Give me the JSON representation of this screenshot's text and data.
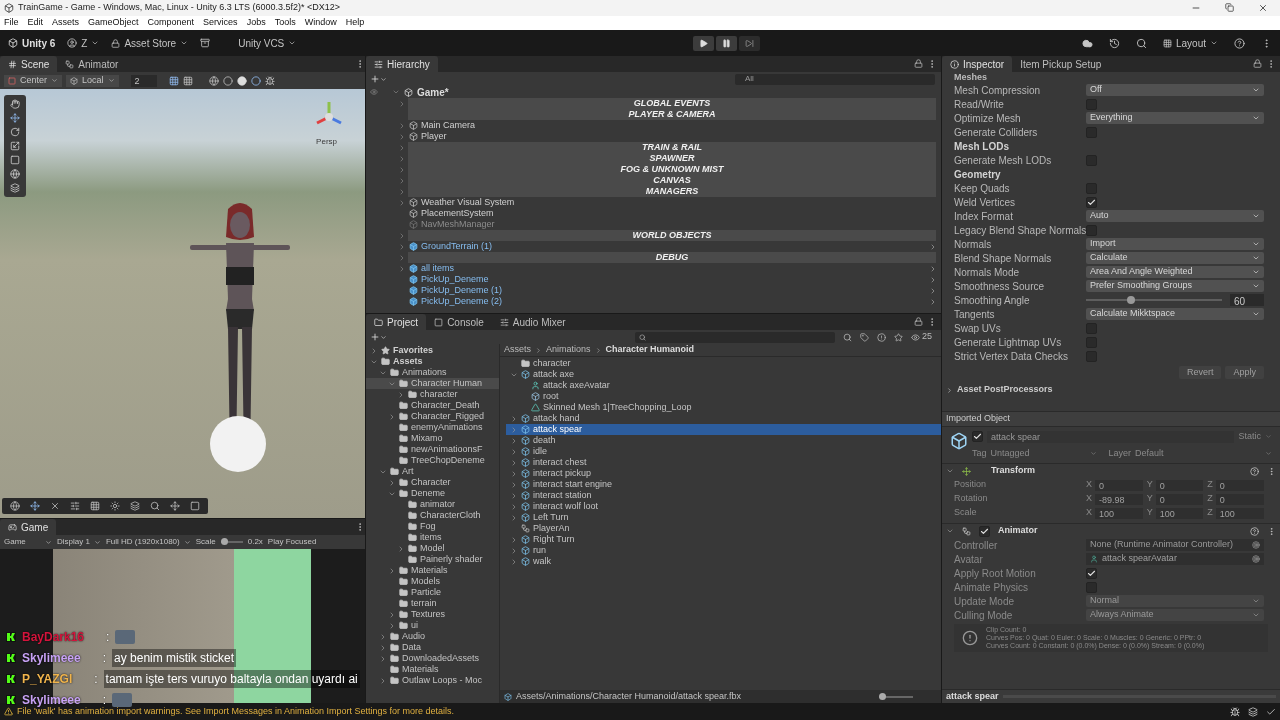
{
  "title_bar": {
    "title": "TrainGame - Game - Windows, Mac, Linux - Unity 6.3 LTS (6000.3.5f2)* <DX12>"
  },
  "menu": [
    "File",
    "Edit",
    "Assets",
    "GameObject",
    "Component",
    "Services",
    "Jobs",
    "Tools",
    "Window",
    "Help"
  ],
  "toolbar": {
    "product": "Unity 6",
    "account": "Z",
    "asset_store": "Asset Store",
    "vcs": "Unity VCS",
    "layout": "Layout"
  },
  "scene": {
    "tabs": [
      {
        "label": "Scene",
        "selected": true
      },
      {
        "label": "Animator",
        "selected": false
      }
    ],
    "pivot": "Center",
    "space": "Local",
    "snap": "2",
    "projection": "Persp"
  },
  "game": {
    "tab": "Game",
    "view": "Game",
    "display": "Display 1",
    "resolution": "Full HD (1920x1080)",
    "scale": {
      "label": "Scale",
      "level": 0.15,
      "reading": "0.2x"
    },
    "play_focused": "Play Focused"
  },
  "chat": [
    {
      "name": "BayDark16",
      "color": "#d4143c",
      "separator": ":",
      "emote": true
    },
    {
      "name": "Skylimeee",
      "color": "#c8a2f5",
      "separator": ":",
      "message": "ay benim mistik sticket",
      "emote": false
    },
    {
      "name": "P_YAZGI",
      "color": "#f0b44c",
      "separator": ":",
      "message": "tamam işte ters vuruyo baltayla ondan uyardı ai",
      "emote": false
    },
    {
      "name": "Skylimeee",
      "color": "#c8a2f5",
      "separator": ":",
      "emote": true
    }
  ],
  "hierarchy": {
    "title": "Hierarchy",
    "search": {
      "placeholder": "All"
    },
    "scene": "Game*",
    "rows": [
      {
        "kind": "header",
        "label": "GLOBAL EVENTS",
        "expandable": true
      },
      {
        "kind": "header",
        "label": "PLAYER & CAMERA",
        "expandable": false
      },
      {
        "kind": "object",
        "label": "Main Camera",
        "expandable": true,
        "prefab": false,
        "disabled": false
      },
      {
        "kind": "object",
        "label": "Player",
        "expandable": true,
        "prefab": false,
        "disabled": false
      },
      {
        "kind": "header",
        "label": "TRAIN & RAIL",
        "expandable": true
      },
      {
        "kind": "header",
        "label": "SPAWNER",
        "expandable": true
      },
      {
        "kind": "header",
        "label": "FOG & UNKNOWN MIST",
        "expandable": true
      },
      {
        "kind": "header",
        "label": "CANVAS",
        "expandable": true
      },
      {
        "kind": "header",
        "label": "MANAGERS",
        "expandable": true
      },
      {
        "kind": "object",
        "label": "Weather Visual System",
        "expandable": true,
        "prefab": false,
        "disabled": false
      },
      {
        "kind": "object",
        "label": "PlacementSystem",
        "expandable": false,
        "prefab": false,
        "disabled": false
      },
      {
        "kind": "object",
        "label": "NavMeshManager",
        "expandable": false,
        "prefab": false,
        "disabled": true
      },
      {
        "kind": "header",
        "label": "WORLD OBJECTS",
        "expandable": true
      },
      {
        "kind": "object",
        "label": "GroundTerrain (1)",
        "expandable": true,
        "prefab": true,
        "disabled": false
      },
      {
        "kind": "header",
        "label": "DEBUG",
        "expandable": true
      },
      {
        "kind": "object",
        "label": "all items",
        "expandable": true,
        "prefab": true,
        "disabled": false
      },
      {
        "kind": "object",
        "label": "PickUp_Deneme",
        "expandable": false,
        "prefab": true,
        "disabled": false
      },
      {
        "kind": "object",
        "label": "PickUp_Deneme (1)",
        "expandable": false,
        "prefab": true,
        "disabled": false
      },
      {
        "kind": "object",
        "label": "PickUp_Deneme (2)",
        "expandable": false,
        "prefab": true,
        "disabled": false
      }
    ]
  },
  "project": {
    "tabs": [
      {
        "label": "Project",
        "selected": true
      },
      {
        "label": "Console",
        "selected": false
      },
      {
        "label": "Audio Mixer",
        "selected": false
      }
    ],
    "visible_count": "25",
    "breadcrumb": [
      "Assets",
      "Animations",
      "Character Humanoid"
    ],
    "tree": [
      {
        "label": "Favorites",
        "kind": "favorites",
        "expanded": false,
        "selected": false
      },
      {
        "label": "Assets",
        "expanded": true,
        "selected": false,
        "children": [
          {
            "label": "Animations",
            "expanded": true,
            "selected": false,
            "children": [
              {
                "label": "Character Human",
                "expanded": true,
                "selected": true,
                "children": [
                  {
                    "label": "character",
                    "expanded": false,
                    "selected": false
                  }
                ]
              },
              {
                "label": "Character_Death",
                "selected": false
              },
              {
                "label": "Character_Rigged",
                "expanded": false,
                "selected": false
              },
              {
                "label": "enemyAnimations",
                "selected": false
              },
              {
                "label": "Mixamo",
                "selected": false
              },
              {
                "label": "newAnimatioonsF",
                "selected": false
              },
              {
                "label": "TreeChopDeneme",
                "selected": false
              }
            ]
          },
          {
            "label": "Art",
            "expanded": true,
            "selected": false,
            "children": [
              {
                "label": "Character",
                "expanded": false,
                "selected": false
              },
              {
                "label": "Deneme",
                "expanded": true,
                "selected": false,
                "children": [
                  {
                    "label": "animator",
                    "selected": false
                  },
                  {
                    "label": "CharacterCloth",
                    "selected": false
                  },
                  {
                    "label": "Fog",
                    "selected": false
                  },
                  {
                    "label": "items",
                    "selected": false
                  },
                  {
                    "label": "Model",
                    "expanded": false,
                    "selected": false
                  },
                  {
                    "label": "Painerly shader",
                    "selected": false
                  }
                ]
              },
              {
                "label": "Materials",
                "expanded": false,
                "selected": false
              },
              {
                "label": "Models",
                "selected": false
              },
              {
                "label": "Particle",
                "selected": false
              },
              {
                "label": "terrain",
                "selected": false
              },
              {
                "label": "Textures",
                "expanded": false,
                "selected": false
              },
              {
                "label": "ui",
                "expanded": false,
                "selected": false
              }
            ]
          },
          {
            "label": "Audio",
            "expanded": false,
            "selected": false
          },
          {
            "label": "Data",
            "expanded": false,
            "selected": false
          },
          {
            "label": "DownloadedAssets",
            "expanded": false,
            "selected": false
          },
          {
            "label": "Materials",
            "selected": false
          },
          {
            "label": "Outlaw Loops - Moc",
            "expanded": false,
            "selected": false
          }
        ]
      }
    ],
    "assets": [
      {
        "kind": "folder",
        "label": "character",
        "selected": false
      },
      {
        "kind": "model",
        "label": "attack axe",
        "expanded": true,
        "selected": false,
        "children": [
          {
            "kind": "avatar",
            "label": "attack axeAvatar",
            "selected": false
          },
          {
            "kind": "object",
            "label": "root",
            "selected": false
          },
          {
            "kind": "mesh",
            "label": "Skinned Mesh 1|TreeChopping_Loop",
            "selected": false
          }
        ]
      },
      {
        "kind": "model",
        "label": "attack hand",
        "expanded": false,
        "selected": false
      },
      {
        "kind": "model",
        "label": "attack spear",
        "expanded": false,
        "selected": true
      },
      {
        "kind": "model",
        "label": "death",
        "expanded": false,
        "selected": false
      },
      {
        "kind": "model",
        "label": "idle",
        "expanded": false,
        "selected": false
      },
      {
        "kind": "model",
        "label": "interact chest",
        "expanded": false,
        "selected": false
      },
      {
        "kind": "model",
        "label": "interact pickup",
        "expanded": false,
        "selected": false
      },
      {
        "kind": "model",
        "label": "interact start engine",
        "expanded": false,
        "selected": false
      },
      {
        "kind": "model",
        "label": "interact station",
        "expanded": false,
        "selected": false
      },
      {
        "kind": "model",
        "label": "interact wolf loot",
        "expanded": false,
        "selected": false
      },
      {
        "kind": "model",
        "label": "Left Turn",
        "expanded": false,
        "selected": false
      },
      {
        "kind": "animator",
        "label": "PlayerAn",
        "selected": false
      },
      {
        "kind": "model",
        "label": "Right Turn",
        "expanded": false,
        "selected": false
      },
      {
        "kind": "model",
        "label": "run",
        "expanded": false,
        "selected": false
      },
      {
        "kind": "model",
        "label": "walk",
        "expanded": false,
        "selected": false
      }
    ],
    "path": "Assets/Animations/Character Humanoid/attack spear.fbx",
    "zoom": {
      "level": 0
    }
  },
  "inspector": {
    "tabs": [
      {
        "label": "Inspector",
        "selected": true
      },
      {
        "label": "Item Pickup Setup",
        "selected": false
      }
    ],
    "section": "Meshes",
    "rows": [
      {
        "kind": "dropdown",
        "label": "Mesh Compression",
        "value": "Off"
      },
      {
        "kind": "checkbox",
        "label": "Read/Write",
        "checked": false
      },
      {
        "kind": "dropdown",
        "label": "Optimize Mesh",
        "value": "Everything"
      },
      {
        "kind": "checkbox",
        "label": "Generate Colliders",
        "checked": false
      },
      {
        "kind": "header",
        "label": "Mesh LODs"
      },
      {
        "kind": "checkbox",
        "label": "Generate Mesh LODs",
        "checked": false
      },
      {
        "kind": "header",
        "label": "Geometry"
      },
      {
        "kind": "checkbox",
        "label": "Keep Quads",
        "checked": false
      },
      {
        "kind": "checkbox",
        "label": "Weld Vertices",
        "checked": true
      },
      {
        "kind": "dropdown",
        "label": "Index Format",
        "value": "Auto"
      },
      {
        "kind": "checkbox",
        "label": "Legacy Blend Shape Normals",
        "checked": false
      },
      {
        "kind": "dropdown",
        "label": "Normals",
        "value": "Import"
      },
      {
        "kind": "dropdown",
        "label": "Blend Shape Normals",
        "value": "Calculate"
      },
      {
        "kind": "dropdown",
        "label": "Normals Mode",
        "value": "Area And Angle Weighted"
      },
      {
        "kind": "dropdown",
        "label": "Smoothness Source",
        "value": "Prefer Smoothing Groups"
      },
      {
        "kind": "slider",
        "label": "Smoothing Angle",
        "level": 0.33,
        "value": "60"
      },
      {
        "kind": "dropdown",
        "label": "Tangents",
        "value": "Calculate Mikktspace"
      },
      {
        "kind": "checkbox",
        "label": "Swap UVs",
        "checked": false
      },
      {
        "kind": "checkbox",
        "label": "Generate Lightmap UVs",
        "checked": false
      },
      {
        "kind": "checkbox",
        "label": "Strict Vertex Data Checks",
        "checked": false
      }
    ],
    "buttons": [
      {
        "label": "Revert",
        "disabled": true
      },
      {
        "label": "Apply",
        "disabled": true
      }
    ],
    "postprocessors": {
      "label": "Asset PostProcessors",
      "expanded": false
    },
    "imported_title": "Imported Object",
    "object": {
      "name": "attack spear",
      "active": true,
      "static_label": "Static",
      "tag_label": "Tag",
      "tag": "Untagged",
      "layer_label": "Layer",
      "layer": "Default"
    },
    "transform": {
      "title": "Transform",
      "expanded": true,
      "rows": [
        {
          "label": "Position",
          "fields": [
            {
              "axis": "X",
              "value": "0"
            },
            {
              "axis": "Y",
              "value": "0"
            },
            {
              "axis": "Z",
              "value": "0"
            }
          ]
        },
        {
          "label": "Rotation",
          "fields": [
            {
              "axis": "X",
              "value": "-89.98"
            },
            {
              "axis": "Y",
              "value": "0"
            },
            {
              "axis": "Z",
              "value": "0"
            }
          ]
        },
        {
          "label": "Scale",
          "fields": [
            {
              "axis": "X",
              "value": "100"
            },
            {
              "axis": "Y",
              "value": "100"
            },
            {
              "axis": "Z",
              "value": "100"
            }
          ]
        }
      ]
    },
    "animator": {
      "title": "Animator",
      "enabled": true,
      "expanded": true,
      "rows": [
        {
          "kind": "object",
          "label": "Controller",
          "value": "None (Runtime Animator Controller)"
        },
        {
          "kind": "avatar",
          "label": "Avatar",
          "value": "attack spearAvatar"
        },
        {
          "kind": "checkbox",
          "label": "Apply Root Motion",
          "checked": true
        },
        {
          "kind": "checkbox",
          "label": "Animate Physics",
          "checked": false
        },
        {
          "kind": "dropdown",
          "label": "Update Mode",
          "value": "Normal"
        },
        {
          "kind": "dropdown",
          "label": "Culling Mode",
          "value": "Always Animate"
        }
      ],
      "info": [
        "Clip Count: 0",
        "Curves Pos: 0 Quat: 0 Euler: 0 Scale: 0 Muscles: 0 Generic: 0 PPtr: 0",
        "Curves Count: 0 Constant: 0 (0.0%) Dense: 0 (0.0%) Stream: 0 (0.0%)"
      ]
    },
    "preview": "attack spear"
  },
  "status_bar": {
    "message": "File 'walk' has animation import warnings. See Import Messages in Animation Import Settings for more details."
  }
}
